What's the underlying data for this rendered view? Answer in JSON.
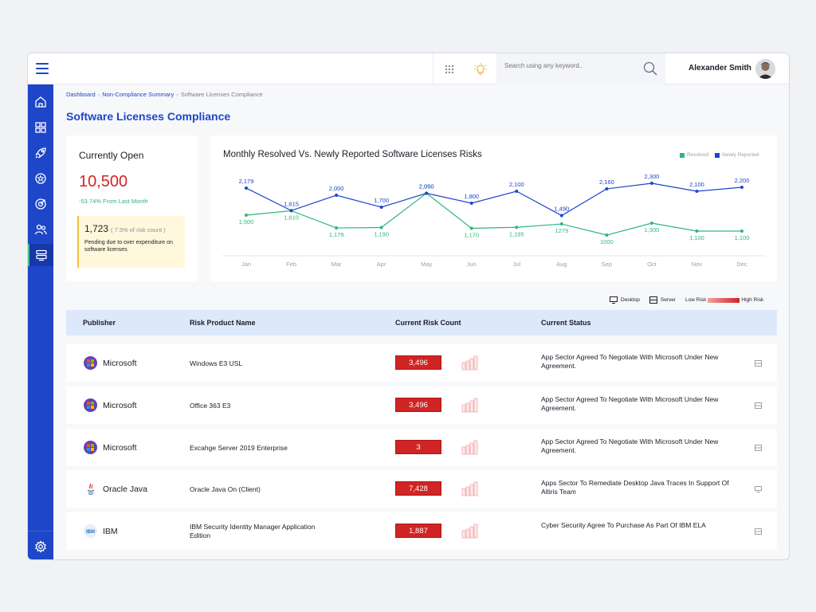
{
  "header": {
    "search_placeholder": "Search using any keyword..",
    "user_name": "Alexander Smith"
  },
  "sidebar": {
    "items": [
      {
        "icon": "home-icon"
      },
      {
        "icon": "grid-icon"
      },
      {
        "icon": "rocket-icon"
      },
      {
        "icon": "badge-icon"
      },
      {
        "icon": "target-icon"
      },
      {
        "icon": "users-icon"
      },
      {
        "icon": "license-icon",
        "active": true
      }
    ],
    "bottom_icon": "settings-icon"
  },
  "breadcrumb": {
    "items": [
      "Dashboard",
      "Non-Compliance Summary",
      "Software Licenses Compliance"
    ]
  },
  "page_title": "Software Licenses Compliance",
  "summary": {
    "title": "Currently Open",
    "value": "10,500",
    "change": "-53.74% From Last Month",
    "pending_count": "1,723",
    "pending_pct": "( 7.5% of risk count )",
    "pending_text": "Pending due to over expenditure on software licenses"
  },
  "chart_data": {
    "type": "line",
    "title": "Monthly Resolved Vs. Newly Reported Software Licenses Risks",
    "categories": [
      "Jan",
      "Feb",
      "Mar",
      "Apr",
      "May",
      "Jun",
      "Jul",
      "Aug",
      "Sep",
      "Oct",
      "Nov",
      "Dec"
    ],
    "series": [
      {
        "name": "Resolved",
        "color": "#2fb67c",
        "values": [
          1500,
          1610,
          1179,
          1190,
          2050,
          1170,
          1195,
          1279,
          1000,
          1300,
          1100,
          1100
        ],
        "labels": [
          "1,500",
          "1,610",
          "1,179",
          "1,190",
          "2,050",
          "1,170",
          "1,195",
          "1279",
          "1000",
          "1,300",
          "1,100",
          "1,100"
        ]
      },
      {
        "name": "Newly Reported",
        "color": "#1d46c8",
        "values": [
          2179,
          1615,
          2000,
          1700,
          2050,
          1800,
          2100,
          1490,
          2160,
          2300,
          2100,
          2200
        ],
        "labels": [
          "2,179",
          "1,615",
          "2,000",
          "1,700",
          "2,050",
          "1,800",
          "2,100",
          "1,490",
          "2,160",
          "2,300",
          "2,100",
          "2,200"
        ]
      }
    ],
    "legend_position": "top-right",
    "grid": false
  },
  "type_legend": {
    "desktop": "Desktop",
    "server": "Server",
    "low": "Low Risk",
    "high": "High Risk"
  },
  "table": {
    "headers": [
      "Publisher",
      "Risk Product Name",
      "Current Risk Count",
      "Current Status"
    ],
    "rows": [
      {
        "publisher": "Microsoft",
        "logo": "microsoft-logo",
        "product": "Windows E3 USL",
        "count": "3,496",
        "status": "App Sector Agreed To Negotiate With Microsoft Under New Agreement.",
        "type": "server-icon"
      },
      {
        "publisher": "Microsoft",
        "logo": "microsoft-logo",
        "product": "Office 363 E3",
        "count": "3,496",
        "status": "App Sector Agreed To Negotiate With  Microsoft Under New Agreement.",
        "type": "server-icon"
      },
      {
        "publisher": "Microsoft",
        "logo": "microsoft-logo",
        "product": "Excahge Server 2019 Enterprise",
        "count": "3",
        "status": "App Sector Agreed To Negotiate With Microsoft Under New Agreement.",
        "type": "server-icon"
      },
      {
        "publisher": "Oracle Java",
        "logo": "java-logo",
        "product": "Oracle Java On (Client)",
        "count": "7,428",
        "status": "Apps Sector To Remediate Desktop Java Traces In Support Of Altiris Team",
        "type": "desktop-icon"
      },
      {
        "publisher": "IBM",
        "logo": "ibm-logo",
        "product": "IBM  Security Identity Manager Application Edition",
        "count": "1,887",
        "status": "Cyber Security Agree To Purchase As Part  Of IBM ELA",
        "type": "server-icon"
      }
    ]
  }
}
